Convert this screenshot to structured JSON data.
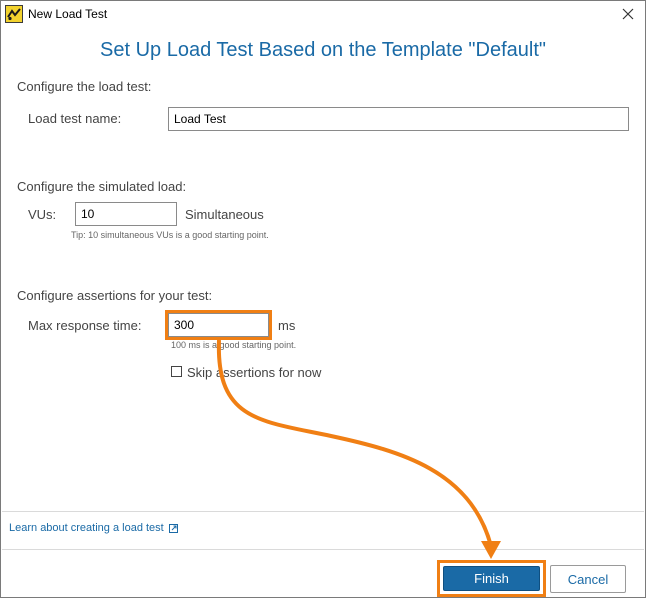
{
  "window": {
    "title": "New Load Test",
    "icons": {
      "app": "load-test-app-icon",
      "close": "close-icon"
    }
  },
  "heading": "Set Up Load Test Based on the Template \"Default\"",
  "load_test": {
    "section_label": "Configure the load test:",
    "name_label": "Load test name:",
    "name_value": "Load Test"
  },
  "simulated_load": {
    "section_label": "Configure the simulated load:",
    "vus_label": "VUs:",
    "vus_value": "10",
    "unit_label": "Simultaneous",
    "tip": "Tip: 10 simultaneous VUs is a good starting point."
  },
  "assertions": {
    "section_label": "Configure assertions for your test:",
    "max_response_label": "Max response time:",
    "max_response_value": "300",
    "unit_label": "ms",
    "tip": "100 ms is a good starting point.",
    "skip_label": "Skip assertions for now",
    "skip_checked": false
  },
  "footer": {
    "learn_link": "Learn about creating a load test",
    "finish_label": "Finish",
    "cancel_label": "Cancel"
  },
  "colors": {
    "accent": "#1a6aa6",
    "highlight": "#f07f14"
  }
}
